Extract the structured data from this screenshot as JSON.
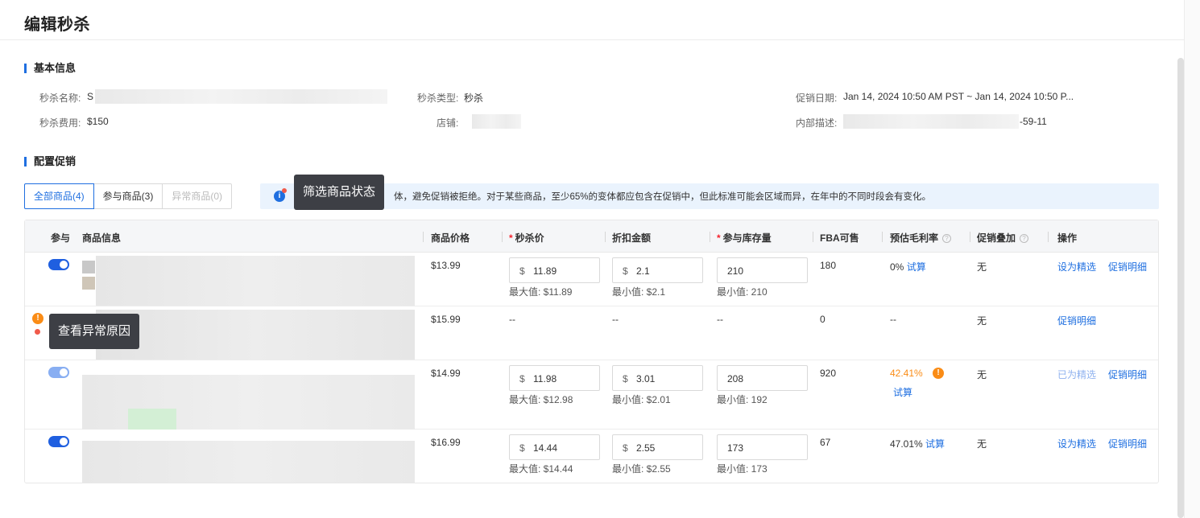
{
  "page": {
    "title": "编辑秒杀"
  },
  "basic_info": {
    "section_title": "基本信息",
    "name_label": "秒杀名称:",
    "name_value": "S",
    "type_label": "秒杀类型:",
    "type_value": "秒杀",
    "date_label": "促销日期:",
    "date_value": "Jan 14, 2024 10:50 AM PST ~ Jan 14, 2024 10:50 P...",
    "fee_label": "秒杀费用:",
    "fee_value": "$150",
    "store_label": "店铺:",
    "desc_label": "内部描述:",
    "desc_value_tail": "-59-11"
  },
  "config": {
    "section_title": "配置促销",
    "filters": [
      {
        "label": "全部商品(4)",
        "state": "active"
      },
      {
        "label": "参与商品(3)",
        "state": "normal"
      },
      {
        "label": "异常商品(0)",
        "state": "disabled"
      }
    ],
    "notice_text": "体，避免促销被拒绝。对于某些商品，至少65%的变体都应包含在促销中，但此标准可能会区域而异，在年中的不同时段会有变化。",
    "notice_icon": "info-icon"
  },
  "tooltips": {
    "filter_status": "筛选商品状态",
    "abnormal_reason": "查看异常原因"
  },
  "table": {
    "headers": {
      "participate": "参与",
      "product_info": "商品信息",
      "price": "商品价格",
      "deal_price": "秒杀价",
      "discount": "折扣金额",
      "stock": "参与库存量",
      "fba": "FBA可售",
      "margin": "预估毛利率",
      "stacking": "促销叠加",
      "actions": "操作"
    },
    "rows": [
      {
        "toggle": "on",
        "price": "$13.99",
        "currency": "$",
        "deal_price": "11.89",
        "deal_hint": "最大值: $11.89",
        "discount": "2.1",
        "discount_hint": "最小值: $2.1",
        "stock": "210",
        "stock_hint": "最小值: 210",
        "fba": "180",
        "margin": "0%",
        "calc": "试算",
        "stacking": "无",
        "action1": "设为精选",
        "action2": "促销明细"
      },
      {
        "toggle": "error",
        "price": "$15.99",
        "deal_price": "--",
        "discount": "--",
        "stock": "--",
        "fba": "0",
        "margin": "--",
        "stacking": "无",
        "action2": "促销明细"
      },
      {
        "toggle": "on-dim",
        "price": "$14.99",
        "currency": "$",
        "deal_price": "11.98",
        "deal_hint": "最大值: $12.98",
        "discount": "3.01",
        "discount_hint": "最小值: $2.01",
        "stock": "208",
        "stock_hint": "最小值: 192",
        "fba": "920",
        "margin": "42.41%",
        "calc": "试算",
        "stacking": "无",
        "action1": "已为精选",
        "action2": "促销明细"
      },
      {
        "toggle": "on",
        "price": "$16.99",
        "currency": "$",
        "deal_price": "14.44",
        "deal_hint": "最大值: $14.44",
        "discount": "2.55",
        "discount_hint": "最小值: $2.55",
        "stock": "173",
        "stock_hint": "最小值: 173",
        "fba": "67",
        "margin": "47.01%",
        "calc": "试算",
        "stacking": "无",
        "action1": "设为精选",
        "action2": "促销明细"
      }
    ]
  },
  "colors": {
    "primary": "#1f6fe0",
    "warning": "#fa8c16",
    "error_dot": "#f05a4a",
    "tooltip_bg": "#3d3f45"
  }
}
